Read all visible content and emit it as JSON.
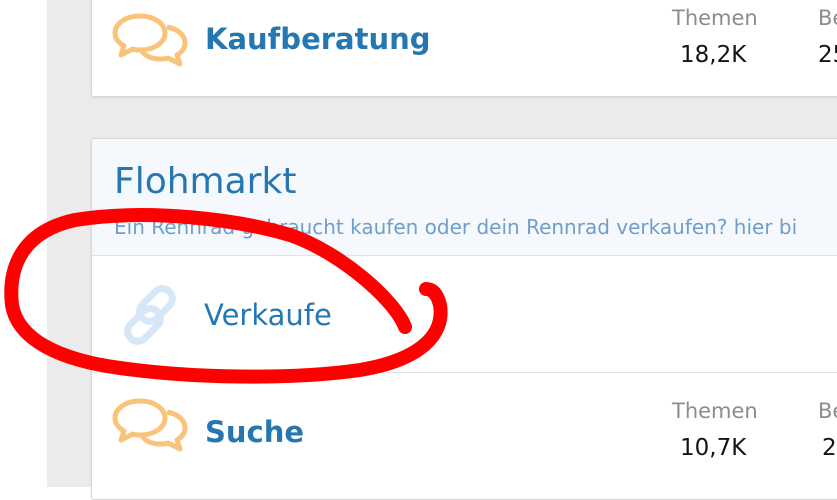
{
  "forums": {
    "kaufberatung": {
      "title": "Kaufberatung",
      "stat1_label": "Themen",
      "stat1_value": "18,2K",
      "stat2_label": "Be",
      "stat2_value": "25"
    },
    "flohmarkt": {
      "title": "Flohmarkt",
      "description": "Ein Rennrad gebraucht kaufen oder dein Rennrad verkaufen? hier bi",
      "link_forum": {
        "title": "Verkaufe",
        "icon": "link-icon"
      },
      "suche": {
        "title": "Suche",
        "stat1_label": "Themen",
        "stat1_value": "10,7K",
        "stat2_label": "Be",
        "stat2_value": "2"
      }
    }
  },
  "icons": {
    "forum": "speech-bubbles-icon",
    "link": "link-icon"
  },
  "colors": {
    "link_blue": "#2577b1",
    "bubble_orange": "#f9c479",
    "annotation_red": "#ff0000",
    "category_bg": "#f5f9fd"
  }
}
